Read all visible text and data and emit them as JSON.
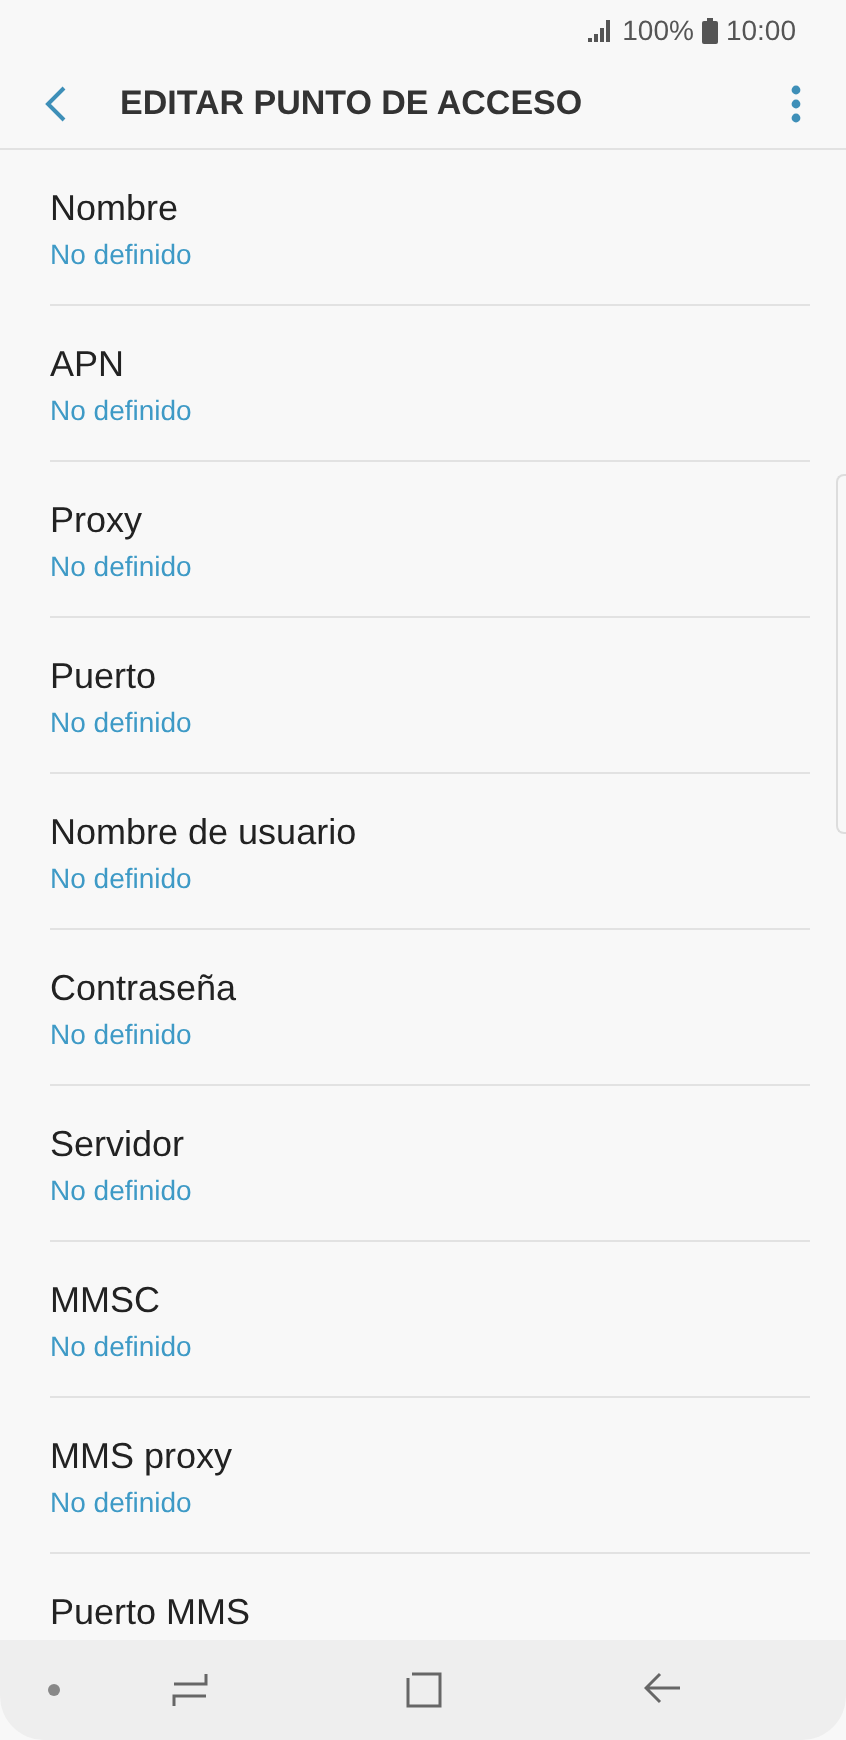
{
  "status_bar": {
    "battery": "100%",
    "time": "10:00"
  },
  "header": {
    "title": "EDITAR PUNTO DE ACCESO"
  },
  "settings": [
    {
      "label": "Nombre",
      "value": "No definido"
    },
    {
      "label": "APN",
      "value": "No definido"
    },
    {
      "label": "Proxy",
      "value": "No definido"
    },
    {
      "label": "Puerto",
      "value": "No definido"
    },
    {
      "label": "Nombre de usuario",
      "value": "No definido"
    },
    {
      "label": "Contraseña",
      "value": "No definido"
    },
    {
      "label": "Servidor",
      "value": "No definido"
    },
    {
      "label": "MMSC",
      "value": "No definido"
    },
    {
      "label": "MMS proxy",
      "value": "No definido"
    },
    {
      "label": "Puerto MMS"
    }
  ]
}
